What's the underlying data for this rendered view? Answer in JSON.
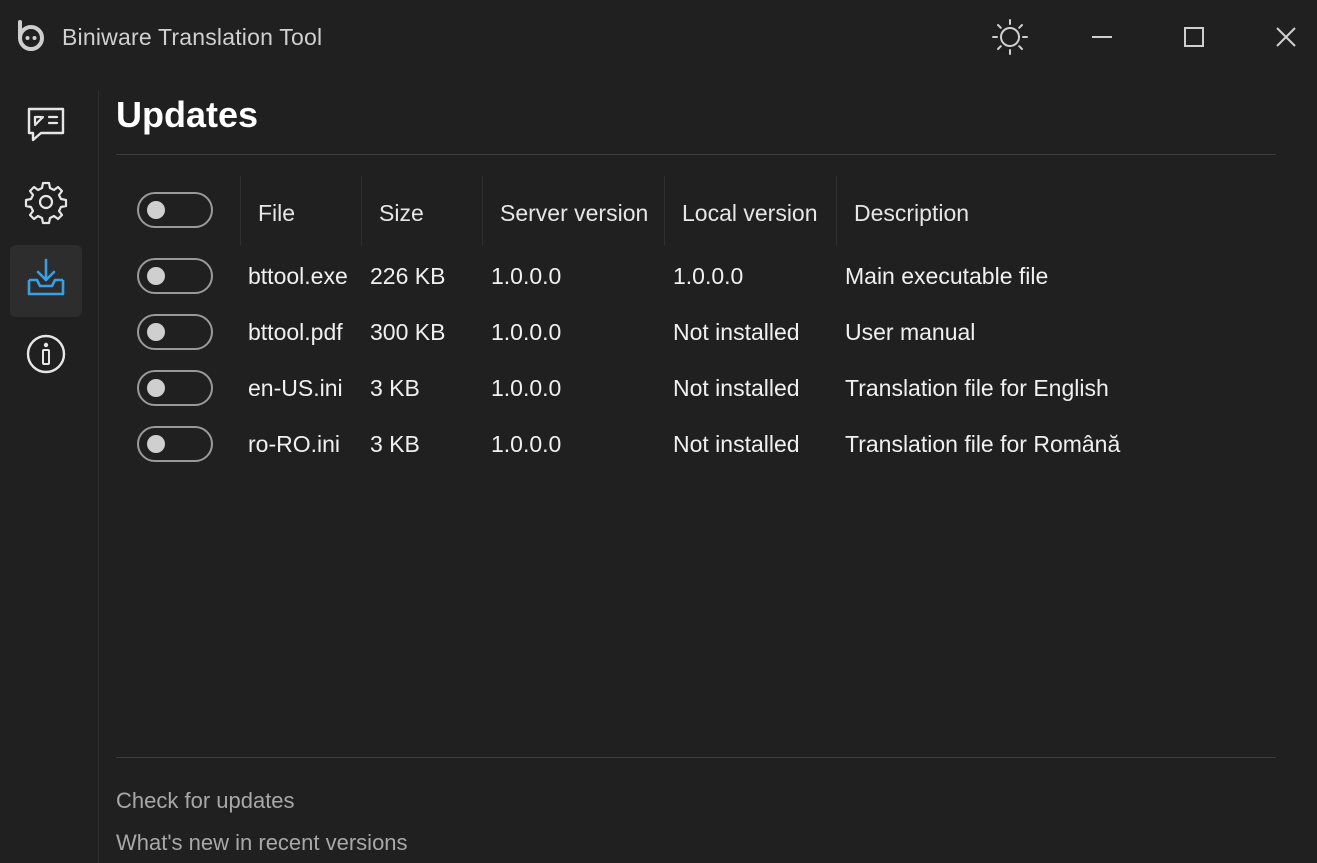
{
  "window": {
    "title": "Biniware Translation Tool",
    "accent_color": "#3aa0e6",
    "background": "#202020"
  },
  "titlebar_icons": {
    "logo": "biniware-logo-icon",
    "theme": "sun-icon",
    "minimize": "minimize-icon",
    "maximize": "maximize-icon",
    "close": "close-icon"
  },
  "sidebar": {
    "items": [
      {
        "icon": "translate-chat-icon",
        "active": false
      },
      {
        "icon": "gear-icon",
        "active": false
      },
      {
        "icon": "download-tray-icon",
        "active": true
      },
      {
        "icon": "info-icon",
        "active": false
      }
    ]
  },
  "page": {
    "title": "Updates"
  },
  "table": {
    "headers": {
      "file": "File",
      "size": "Size",
      "server": "Server version",
      "local": "Local version",
      "description": "Description"
    },
    "select_all_on": false,
    "rows": [
      {
        "selected": false,
        "file": "bttool.exe",
        "size": "226 KB",
        "server": "1.0.0.0",
        "local": "1.0.0.0",
        "description": "Main executable file"
      },
      {
        "selected": false,
        "file": "bttool.pdf",
        "size": "300 KB",
        "server": "1.0.0.0",
        "local": "Not installed",
        "description": "User manual"
      },
      {
        "selected": false,
        "file": "en-US.ini",
        "size": "3 KB",
        "server": "1.0.0.0",
        "local": "Not installed",
        "description": "Translation file for English"
      },
      {
        "selected": false,
        "file": "ro-RO.ini",
        "size": "3 KB",
        "server": "1.0.0.0",
        "local": "Not installed",
        "description": "Translation file for Română"
      }
    ]
  },
  "links": {
    "check_updates": "Check for updates",
    "whats_new": "What's new in recent versions"
  }
}
